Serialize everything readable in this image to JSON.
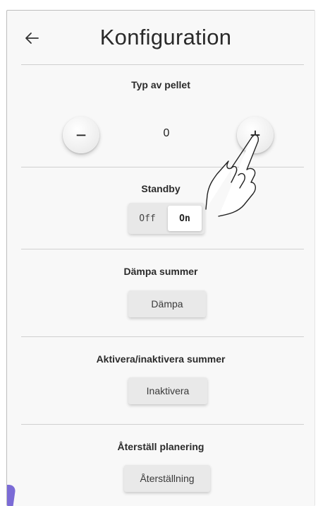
{
  "header": {
    "title": "Konfiguration",
    "back_icon": "arrow-left-icon"
  },
  "pellet": {
    "label": "Typ av pellet",
    "value": "0",
    "decrement_label": "−",
    "increment_label": "+"
  },
  "standby": {
    "label": "Standby",
    "off_label": "Off",
    "on_label": "On",
    "selected": "On"
  },
  "mute": {
    "label": "Dämpa summer",
    "button_label": "Dämpa"
  },
  "toggle_buzzer": {
    "label": "Aktivera/inaktivera summer",
    "button_label": "Inaktivera"
  },
  "reset": {
    "label": "Återställ planering",
    "button_label": "Återställning"
  },
  "overlay": {
    "gesture_icon": "tap-hand-icon"
  },
  "colors": {
    "accent": "#7b6bd6",
    "background": "#f8f8f8",
    "button": "#e9e9e9"
  }
}
